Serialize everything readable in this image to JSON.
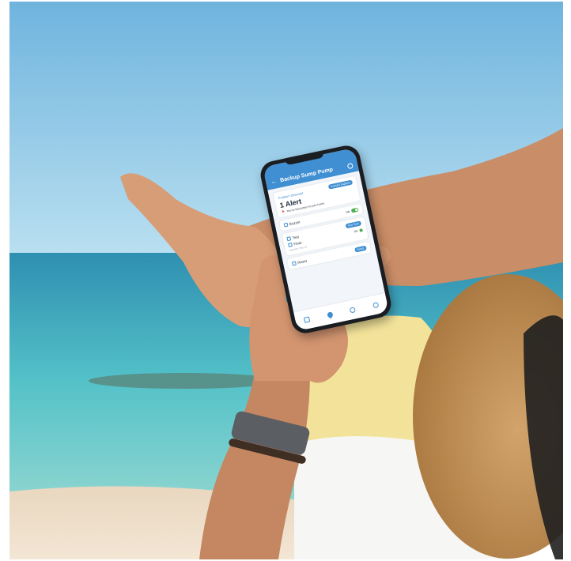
{
  "app": {
    "title": "Backup Sump Pump",
    "problem_label": "Problem Detected",
    "support_button": "Contact Support",
    "alert_count": "1 Alert",
    "alert_message": "You've lost power to your home.",
    "items": [
      {
        "label": "Buzzer",
        "state": "ON",
        "control": "toggle"
      },
      {
        "label": "Test",
        "state": "",
        "control": "Run Test"
      },
      {
        "label": "Float",
        "state": "OK",
        "control": "dot"
      },
      {
        "label": "Reset",
        "state": "",
        "control": "Reset"
      }
    ],
    "hint": "Last test: Sep 15"
  },
  "colors": {
    "accent": "#3f8fd2",
    "alert": "#e23b3b",
    "ok": "#4caf50"
  },
  "icons": [
    "back-arrow-icon",
    "settings-icon",
    "warning-icon",
    "home-icon",
    "water-drop-icon",
    "clock-icon",
    "help-icon"
  ]
}
